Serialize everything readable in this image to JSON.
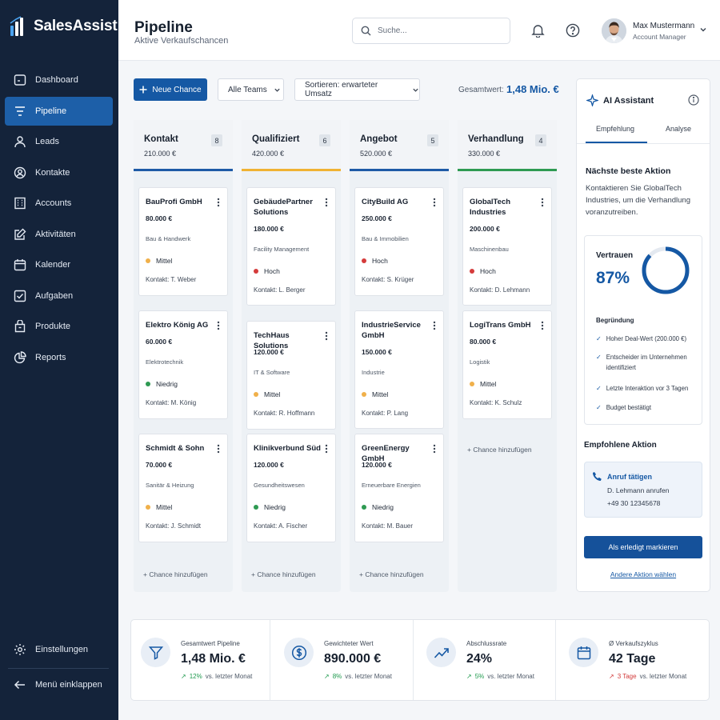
{
  "app": {
    "name": "SalesAssist"
  },
  "sidebar": {
    "items": [
      {
        "label": "Dashboard",
        "icon": "dashboard-icon"
      },
      {
        "label": "Pipeline",
        "icon": "pipeline-icon",
        "active": true
      },
      {
        "label": "Leads",
        "icon": "user-icon"
      },
      {
        "label": "Kontakte",
        "icon": "contact-icon"
      },
      {
        "label": "Accounts",
        "icon": "building-icon"
      },
      {
        "label": "Aktivitäten",
        "icon": "edit-icon"
      },
      {
        "label": "Kalender",
        "icon": "calendar-icon"
      },
      {
        "label": "Aufgaben",
        "icon": "checkbox-icon"
      },
      {
        "label": "Produkte",
        "icon": "package-icon"
      },
      {
        "label": "Reports",
        "icon": "pie-chart-icon"
      }
    ],
    "settings_label": "Einstellungen",
    "collapse_label": "Menü einklappen"
  },
  "header": {
    "title": "Pipeline",
    "subtitle": "Aktive Verkaufschancen",
    "search_placeholder": "Suche...",
    "user_name": "Max Mustermann",
    "user_role": "Account Manager"
  },
  "toolbar": {
    "new_button": "Neue Chance",
    "team_filter": "Alle Teams",
    "sort": "Sortieren: erwarteter Umsatz",
    "total_label": "Gesamtwert:",
    "total_value": "1,48 Mio. €"
  },
  "columns": [
    {
      "title": "Kontakt",
      "value": "210.000 €",
      "count": "8",
      "color": "#1e5aa6",
      "cards": [
        {
          "name": "BauProfi GmbH",
          "amount": "80.000 €",
          "industry": "Bau & Handwerk",
          "priority": "Mittel",
          "prio_color": "#f0b04a",
          "contact": "Kontakt: T. Weber"
        },
        {
          "name": "Elektro König AG",
          "amount": "60.000 €",
          "industry": "Elektrotechnik",
          "priority": "Niedrig",
          "prio_color": "#2e9a52",
          "contact": "Kontakt: M. König"
        },
        {
          "name": "Schmidt & Sohn",
          "amount": "70.000 €",
          "industry": "Sanitär & Heizung",
          "priority": "Mittel",
          "prio_color": "#f0b04a",
          "contact": "Kontakt: J. Schmidt"
        }
      ],
      "add_label": "+  Chance hinzufügen"
    },
    {
      "title": "Qualifiziert",
      "value": "420.000 €",
      "count": "6",
      "color": "#f0b233",
      "cards": [
        {
          "name": "GebäudePartner Solutions",
          "amount": "180.000 €",
          "industry": "Facility Management",
          "priority": "Hoch",
          "prio_color": "#d53b3b",
          "contact": "Kontakt: L. Berger"
        },
        {
          "name": "TechHaus Solutions",
          "amount": "120.000 €",
          "industry": "IT & Software",
          "priority": "Mittel",
          "prio_color": "#f0b04a",
          "contact": "Kontakt: R. Hoffmann"
        },
        {
          "name": "Klinikverbund Süd",
          "amount": "120.000 €",
          "industry": "Gesundheitswesen",
          "priority": "Niedrig",
          "prio_color": "#2e9a52",
          "contact": "Kontakt: A. Fischer"
        }
      ],
      "add_label": "+  Chance hinzufügen"
    },
    {
      "title": "Angebot",
      "value": "520.000 €",
      "count": "5",
      "color": "#1e5aa6",
      "cards": [
        {
          "name": "CityBuild AG",
          "amount": "250.000 €",
          "industry": "Bau & Immobilien",
          "priority": "Hoch",
          "prio_color": "#d53b3b",
          "contact": "Kontakt: S. Krüger"
        },
        {
          "name": "IndustrieService GmbH",
          "amount": "150.000 €",
          "industry": "Industrie",
          "priority": "Mittel",
          "prio_color": "#f0b04a",
          "contact": "Kontakt: P. Lang"
        },
        {
          "name": "GreenEnergy GmbH",
          "amount": "120.000 €",
          "industry": "Erneuerbare Energien",
          "priority": "Niedrig",
          "prio_color": "#2e9a52",
          "contact": "Kontakt: M. Bauer"
        }
      ],
      "add_label": "+  Chance hinzufügen"
    },
    {
      "title": "Verhandlung",
      "value": "330.000 €",
      "count": "4",
      "color": "#2e9a52",
      "cards": [
        {
          "name": "GlobalTech Industries",
          "amount": "200.000 €",
          "industry": "Maschinenbau",
          "priority": "Hoch",
          "prio_color": "#d53b3b",
          "contact": "Kontakt: D. Lehmann"
        },
        {
          "name": "LogiTrans GmbH",
          "amount": "80.000 €",
          "industry": "Logistik",
          "priority": "Mittel",
          "prio_color": "#f0b04a",
          "contact": "Kontakt: K. Schulz"
        }
      ],
      "add_label": "+  Chance hinzufügen"
    }
  ],
  "ai": {
    "title": "AI Assistant",
    "tabs": [
      "Empfehlung",
      "Analyse"
    ],
    "nba_title": "Nächste beste Aktion",
    "nba_text": "Kontaktieren Sie GlobalTech Industries, um die Verhandlung voranzutreiben.",
    "confidence_label": "Vertrauen",
    "confidence_value": "87%",
    "confidence": 0.87,
    "reason_title": "Begründung",
    "reasons": [
      "Hoher Deal-Wert (200.000 €)",
      "Entscheider im Unternehmen identifiziert",
      "Letzte Interaktion vor 3 Tagen",
      "Budget bestätigt"
    ],
    "rec_title": "Empfohlene Aktion",
    "rec_action": "Anruf tätigen",
    "rec_target": "D. Lehmann anrufen",
    "rec_phone": "+49 30 12345678",
    "done_button": "Als erledigt markieren",
    "other_link": "Andere Aktion wählen"
  },
  "kpis": [
    {
      "label": "Gesamtwert Pipeline",
      "value": "1,48 Mio. €",
      "delta": "12%",
      "delta_text": "vs. letzter Monat",
      "trend": "up",
      "icon": "funnel-icon"
    },
    {
      "label": "Gewichteter Wert",
      "value": "890.000 €",
      "delta": "8%",
      "delta_text": "vs. letzter Monat",
      "trend": "up",
      "icon": "dollar-icon"
    },
    {
      "label": "Abschlussrate",
      "value": "24%",
      "delta": "5%",
      "delta_text": "vs. letzter Monat",
      "trend": "up",
      "icon": "trend-icon"
    },
    {
      "label": "Ø Verkaufszyklus",
      "value": "42 Tage",
      "delta": "3 Tage",
      "delta_text": "vs. letzter Monat",
      "trend": "down",
      "icon": "calendar-icon"
    }
  ],
  "colors": {
    "sidebar": "#14233a",
    "accent": "#1558a4",
    "high": "#d53b3b",
    "medium": "#f0b04a",
    "low": "#2e9a52"
  }
}
